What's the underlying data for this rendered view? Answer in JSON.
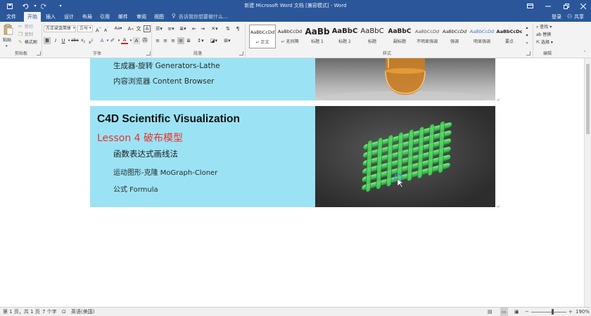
{
  "window": {
    "title": "新建 Microsoft Word 文档 [兼容模式] - Word",
    "colors": {
      "titlebar": "#2b579a",
      "ribbon": "#f3f3f3",
      "slide_cyan": "#9be3f4",
      "lesson_red": "#e8322b"
    }
  },
  "qat": {
    "save_icon": "save-icon",
    "undo_icon": "undo-icon",
    "redo_icon": "redo-icon",
    "customize_icon": "customize-qat-icon"
  },
  "window_buttons": {
    "ribbon_options_icon": "ribbon-display-options-icon",
    "minimize_icon": "minimize-icon",
    "restore_icon": "restore-icon",
    "close_icon": "close-icon"
  },
  "tabs": [
    {
      "label": "文件"
    },
    {
      "label": "开始"
    },
    {
      "label": "插入"
    },
    {
      "label": "设计"
    },
    {
      "label": "布局"
    },
    {
      "label": "引用"
    },
    {
      "label": "邮件"
    },
    {
      "label": "审阅"
    },
    {
      "label": "视图"
    }
  ],
  "tell_me": "告诉我你想要做什么...",
  "account": {
    "signin": "登录",
    "share": "共享"
  },
  "ribbon": {
    "clipboard": {
      "paste": "粘贴",
      "cut": "剪切",
      "copy": "复制",
      "format_painter": "格式刷",
      "label": "剪贴板"
    },
    "font": {
      "name": "方正梁金简体",
      "size": "三号",
      "label": "字体"
    },
    "paragraph": {
      "label": "段落"
    },
    "styles": {
      "items": [
        {
          "sample": "AaBbCcDd",
          "name": "↵ 正文"
        },
        {
          "sample": "AaBbCcDd",
          "name": "↵ 无间隔"
        },
        {
          "sample": "AaBb",
          "name": "标题 1"
        },
        {
          "sample": "AaBbC",
          "name": "标题 2"
        },
        {
          "sample": "AaBbC",
          "name": "标题"
        },
        {
          "sample": "AaBbC",
          "name": "副标题"
        },
        {
          "sample": "AaBbCcDd",
          "name": "不明显强调"
        },
        {
          "sample": "AaBbCcDd",
          "name": "强调"
        },
        {
          "sample": "AaBbCcDd",
          "name": "明显强调"
        },
        {
          "sample": "AaBbCcDc",
          "name": "要点"
        }
      ],
      "label": "样式"
    },
    "editing": {
      "find": "查找",
      "replace": "替换",
      "select": "选择",
      "label": "编辑"
    }
  },
  "document": {
    "slide1": {
      "line1": "生成器-旋转 Generators-Lathe",
      "line2": "内容浏览器 Content Browser"
    },
    "slide2": {
      "title": "C4D Scientific Visualization",
      "lesson": "Lesson 4 破布模型",
      "line1": "函数表达式画线法",
      "line2": "运动图形-克隆 MoGraph-Cloner",
      "line3": "公式 Formula"
    }
  },
  "status": {
    "page": "第 1 页，共 1 页",
    "words": "7 个字",
    "language": "英语(美国)",
    "zoom": "190%"
  }
}
